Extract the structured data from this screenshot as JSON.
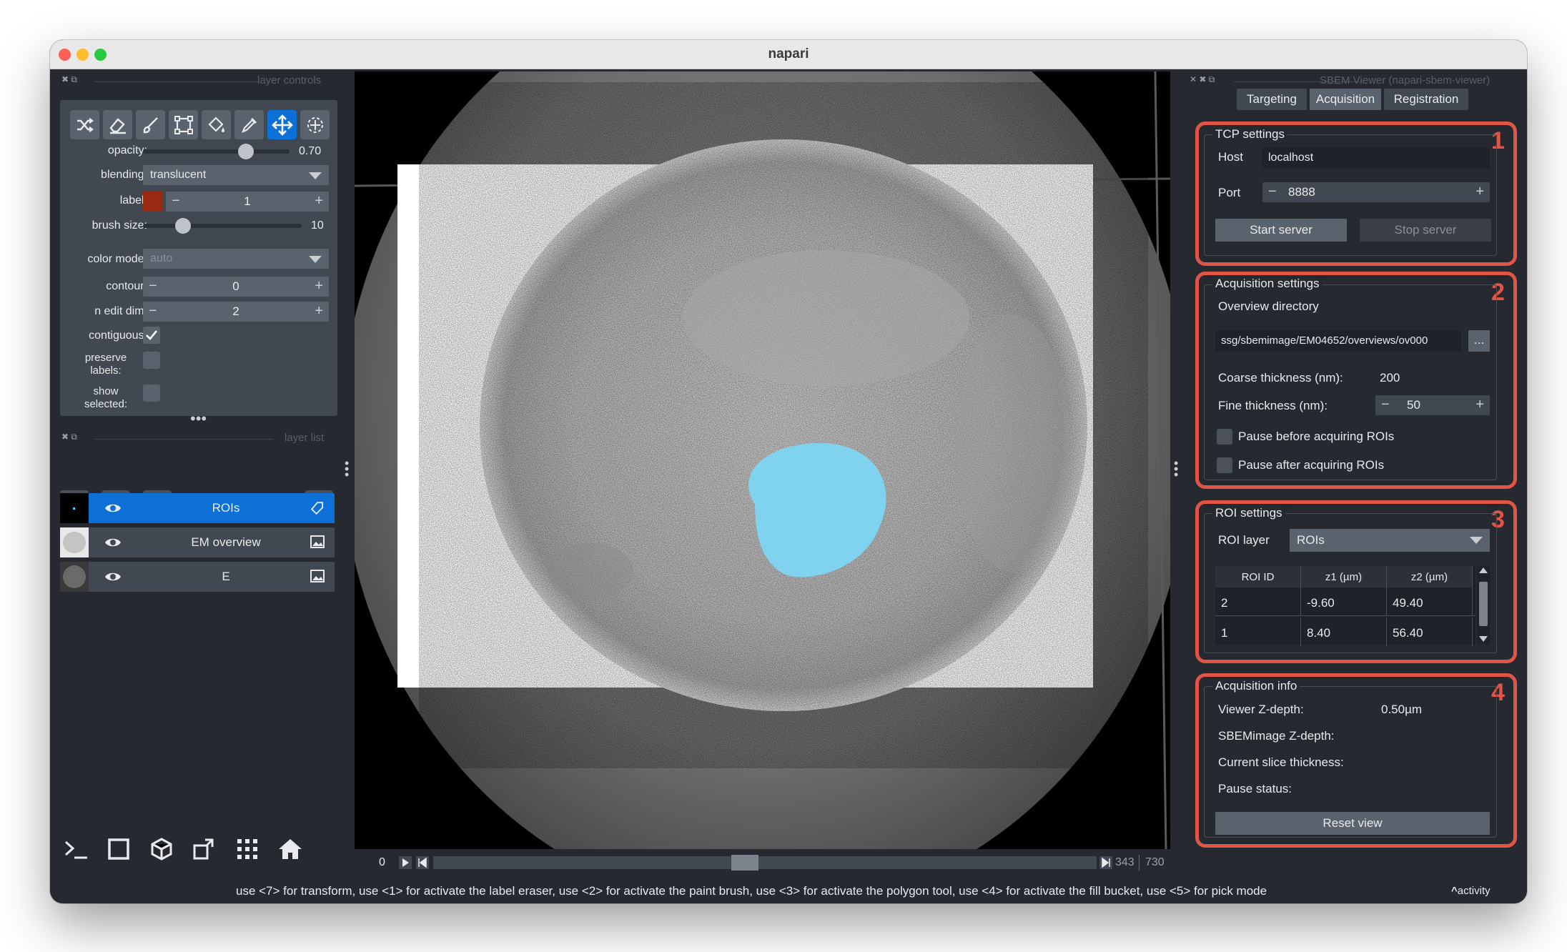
{
  "window": {
    "title": "napari"
  },
  "layer_controls": {
    "dock_title": "layer controls",
    "opacity_label": "opacity:",
    "opacity_value": "0.70",
    "opacity_fraction": 0.7,
    "blending_label": "blending:",
    "blending_value": "translucent",
    "label_label": "label:",
    "label_value": "1",
    "label_color": "#9a2a12",
    "brush_size_label": "brush size:",
    "brush_size_value": "10",
    "color_mode_label": "color mode:",
    "color_mode_value": "auto",
    "contour_label": "contour:",
    "contour_value": "0",
    "n_edit_dim_label": "n edit dim:",
    "n_edit_dim_value": "2",
    "contiguous_label": "contiguous:",
    "preserve_labels_label_1": "preserve",
    "preserve_labels_label_2": "labels:",
    "show_selected_label_1": "show",
    "show_selected_label_2": "selected:"
  },
  "layer_list": {
    "dock_title": "layer list",
    "layers": [
      {
        "name": "ROIs",
        "selected": true
      },
      {
        "name": "EM overview",
        "selected": false
      },
      {
        "name": "E",
        "selected": false
      }
    ]
  },
  "dims_slider": {
    "start": "0",
    "current": "343",
    "total": "730",
    "position_fraction": 0.47
  },
  "status_bar": {
    "message": "use <7> for transform, use <1> for activate the label eraser, use <2> for activate the paint brush, use <3> for activate the polygon tool, use <4> for activate the fill bucket, use <5> for pick mode",
    "activity": "activity"
  },
  "plugin": {
    "dock_title": "SBEM Viewer (napari-sbem-viewer)",
    "tabs": [
      {
        "label": "Targeting",
        "active": false
      },
      {
        "label": "Acquisition",
        "active": true
      },
      {
        "label": "Registration",
        "active": false
      }
    ],
    "annotation_color": "#e05546",
    "annotations": [
      "1",
      "2",
      "3",
      "4"
    ],
    "tcp": {
      "title": "TCP settings",
      "host_label": "Host",
      "host_value": "localhost",
      "port_label": "Port",
      "port_value": "8888",
      "start_button": "Start server",
      "stop_button": "Stop server"
    },
    "acquisition_settings": {
      "title": "Acquisition settings",
      "overview_dir_label": "Overview directory",
      "overview_dir_value": "ssg/sbemimage/EM04652/overviews/ov000",
      "browse_button": "...",
      "coarse_label": "Coarse thickness (nm):",
      "coarse_value": "200",
      "fine_label": "Fine thickness (nm):",
      "fine_value": "50",
      "pause_before_label": "Pause before acquiring ROIs",
      "pause_after_label": "Pause after acquiring ROIs"
    },
    "roi_settings": {
      "title": "ROI settings",
      "roi_layer_label": "ROI layer",
      "roi_layer_value": "ROIs",
      "columns": [
        "ROI ID",
        "z1 (µm)",
        "z2 (µm)"
      ],
      "rows": [
        [
          "2",
          "-9.60",
          "49.40"
        ],
        [
          "1",
          "8.40",
          "56.40"
        ]
      ]
    },
    "acquisition_info": {
      "title": "Acquisition info",
      "viewer_z_label": "Viewer Z-depth:",
      "viewer_z_value": "0.50µm",
      "sbem_z_label": "SBEMimage Z-depth:",
      "slice_thickness_label": "Current slice thickness:",
      "pause_status_label": "Pause status:",
      "reset_button": "Reset view"
    }
  }
}
